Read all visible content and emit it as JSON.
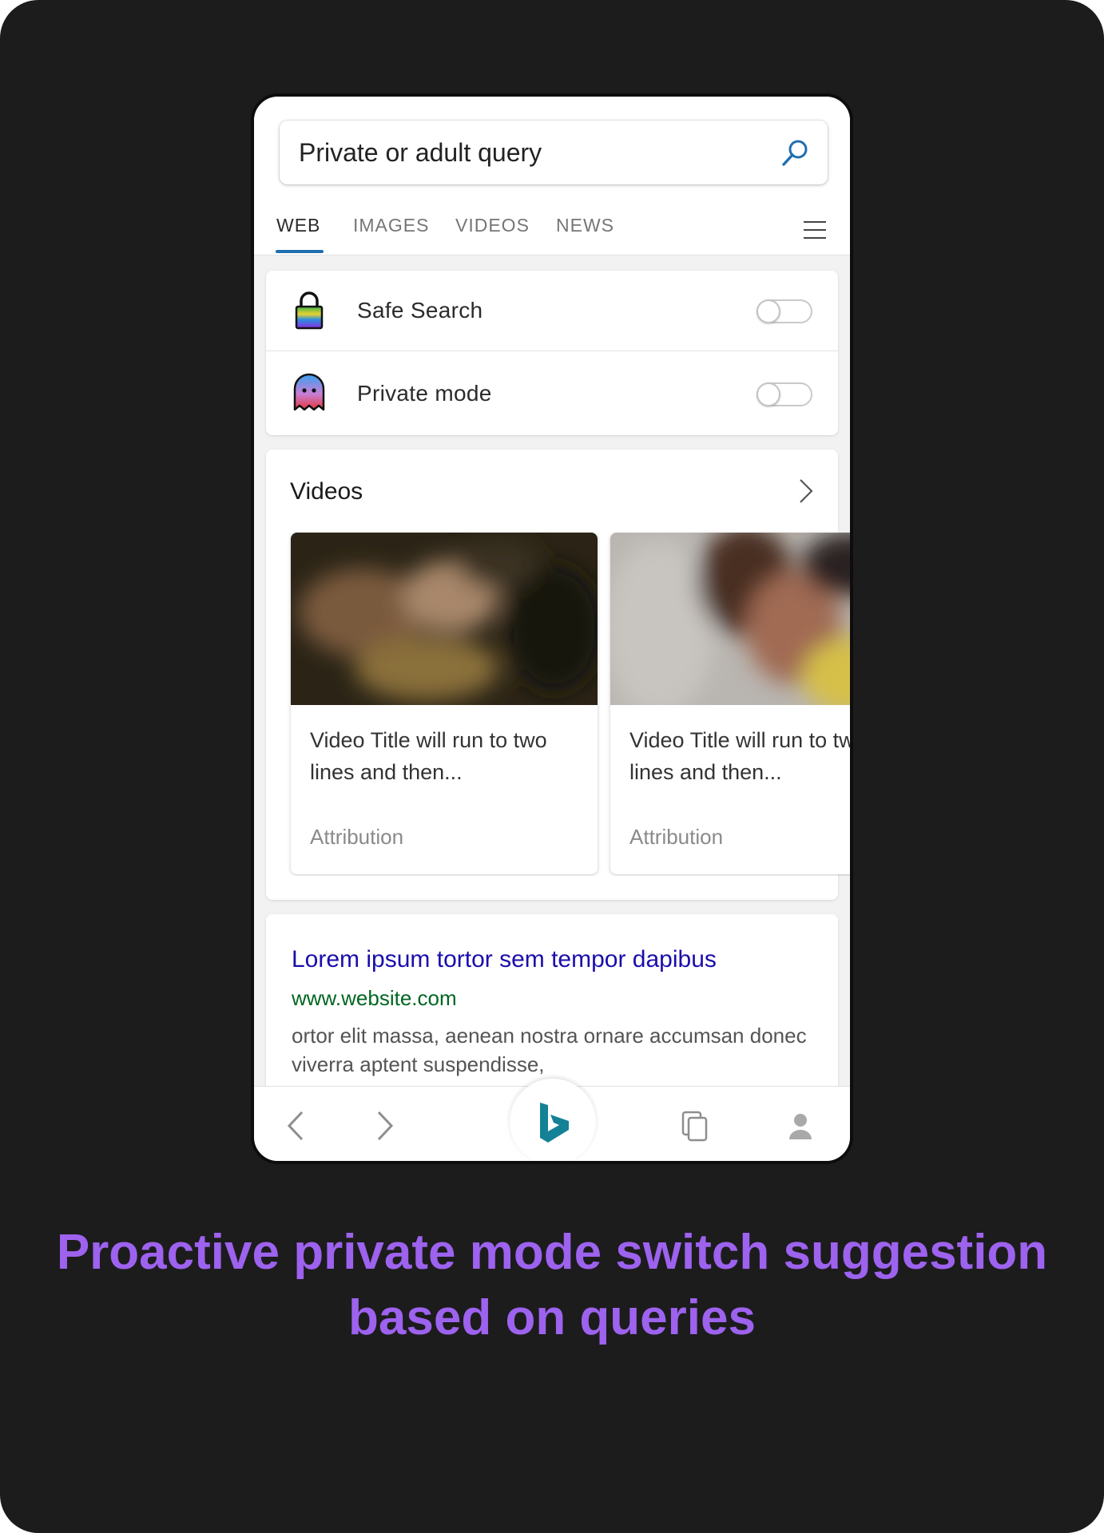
{
  "search": {
    "query": "Private or adult query"
  },
  "tabs": [
    {
      "label": "WEB",
      "active": true
    },
    {
      "label": "IMAGES",
      "active": false
    },
    {
      "label": "VIDEOS",
      "active": false
    },
    {
      "label": "NEWS",
      "active": false
    }
  ],
  "toggles": [
    {
      "label": "Safe Search",
      "icon": "rainbow-lock-icon",
      "on": false
    },
    {
      "label": "Private mode",
      "icon": "ghost-icon",
      "on": false
    }
  ],
  "videos": {
    "title": "Videos",
    "items": [
      {
        "title": "Video Title will run to two lines and then...",
        "attribution": "Attribution"
      },
      {
        "title": "Video Title will run to two lines and then...",
        "attribution": "Attribution"
      }
    ]
  },
  "result": {
    "title": "Lorem ipsum tortor sem tempor dapibus",
    "url": "www.website.com",
    "snippet": "ortor elit massa, aenean nostra ornare accumsan donec viverra aptent suspendisse,"
  },
  "bottom_nav": [
    "back-arrow-icon",
    "forward-arrow-icon",
    "bing-logo-icon",
    "tabs-icon",
    "profile-icon"
  ],
  "caption": "Proactive private mode switch suggestion based on queries",
  "colors": {
    "accent": "#1f6fb0",
    "caption": "#9d62ee",
    "link": "#1a0dab",
    "url": "#006621",
    "background": "#1c1c1d"
  }
}
